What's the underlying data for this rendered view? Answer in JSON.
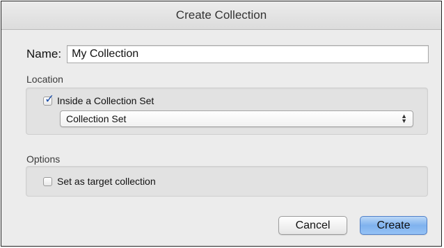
{
  "window": {
    "title": "Create Collection"
  },
  "name": {
    "label": "Name:",
    "value": "My Collection"
  },
  "location": {
    "label": "Location",
    "inside_set": {
      "label": "Inside a Collection Set",
      "checked": true
    },
    "set_select": {
      "value": "Collection Set"
    }
  },
  "options": {
    "label": "Options",
    "target": {
      "label": "Set as target collection",
      "checked": false
    }
  },
  "buttons": {
    "cancel": "Cancel",
    "create": "Create"
  },
  "colors": {
    "accent": "#7fb2ee",
    "checkmark": "#1d4fa8"
  }
}
